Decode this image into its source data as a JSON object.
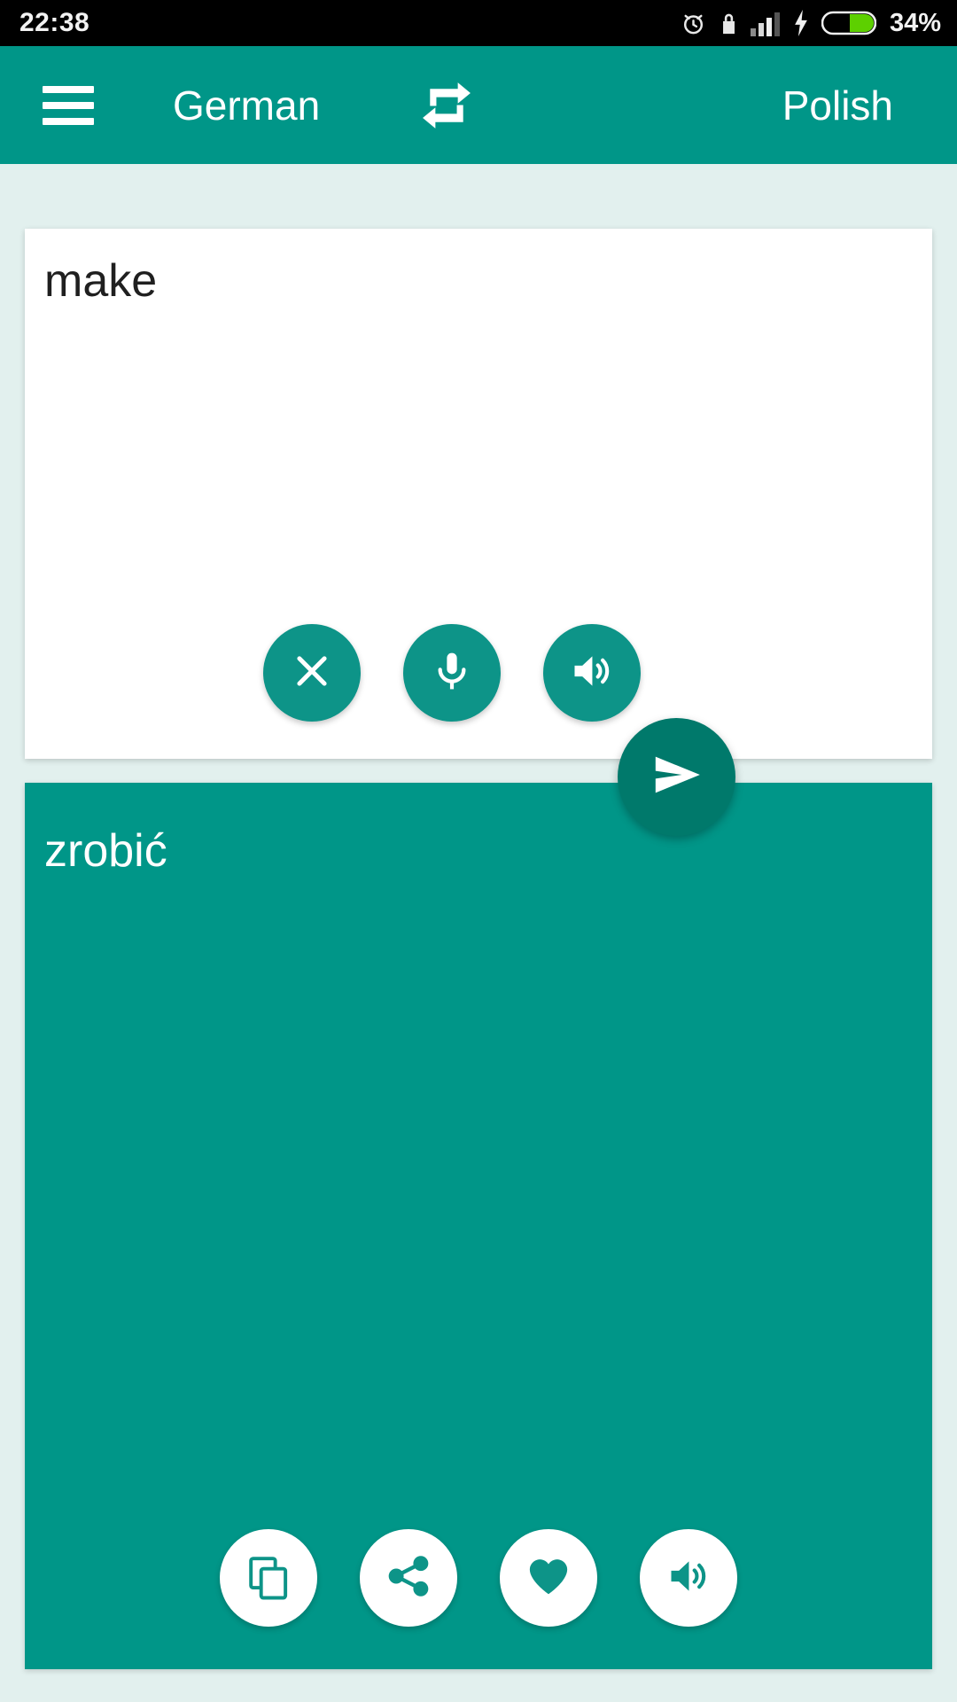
{
  "status_bar": {
    "time": "22:38",
    "battery_percent": "34%",
    "icons": [
      "alarm-icon",
      "lock-icon",
      "signal-icon",
      "charging-bolt-icon",
      "battery-icon"
    ]
  },
  "app_bar": {
    "menu_icon": "hamburger-menu-icon",
    "source_language": "German",
    "swap_icon": "swap-languages-icon",
    "target_language": "Polish"
  },
  "source_panel": {
    "text": "make",
    "placeholder": "",
    "actions": [
      {
        "name": "clear-button",
        "icon": "close-icon"
      },
      {
        "name": "microphone-button",
        "icon": "microphone-icon"
      },
      {
        "name": "speak-source-button",
        "icon": "speaker-icon"
      }
    ]
  },
  "send_button": {
    "icon": "send-icon",
    "label": ""
  },
  "target_panel": {
    "text": "zrobić",
    "actions": [
      {
        "name": "copy-button",
        "icon": "copy-icon"
      },
      {
        "name": "share-button",
        "icon": "share-icon"
      },
      {
        "name": "favorite-button",
        "icon": "heart-icon"
      },
      {
        "name": "speak-target-button",
        "icon": "speaker-icon"
      }
    ]
  },
  "colors": {
    "primary": "#009688",
    "primary_dark": "#00796b",
    "button_teal": "#0d9488",
    "background": "#e2f0ee",
    "status_bar": "#000000",
    "battery_green": "#5dd000"
  }
}
